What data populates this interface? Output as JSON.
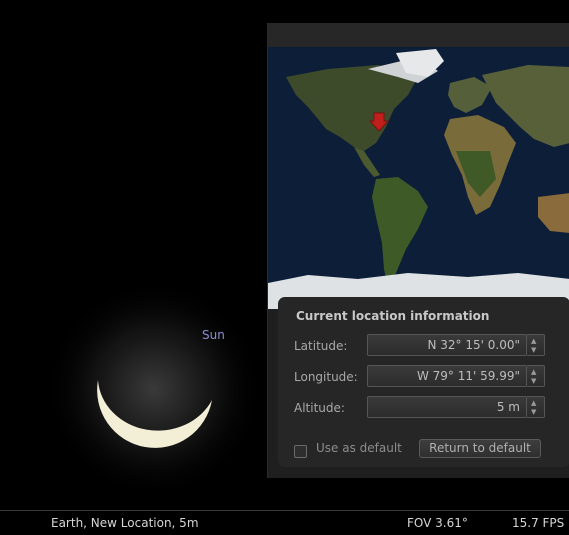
{
  "sky": {
    "sun_label": "Sun"
  },
  "location_window": {
    "map_marker_color": "#c0201b",
    "info_title": "Current location information",
    "latitude": {
      "label": "Latitude:",
      "value": "N 32° 15' 0.00\""
    },
    "longitude": {
      "label": "Longitude:",
      "value": "W 79° 11' 59.99\""
    },
    "altitude": {
      "label": "Altitude:",
      "value": "5 m"
    },
    "use_as_default_label": "Use as default",
    "use_as_default_checked": false,
    "return_default_label": "Return to default"
  },
  "statusbar": {
    "location": "Earth, New Location, 5m",
    "fov": "FOV 3.61°",
    "fps": "15.7 FPS"
  }
}
